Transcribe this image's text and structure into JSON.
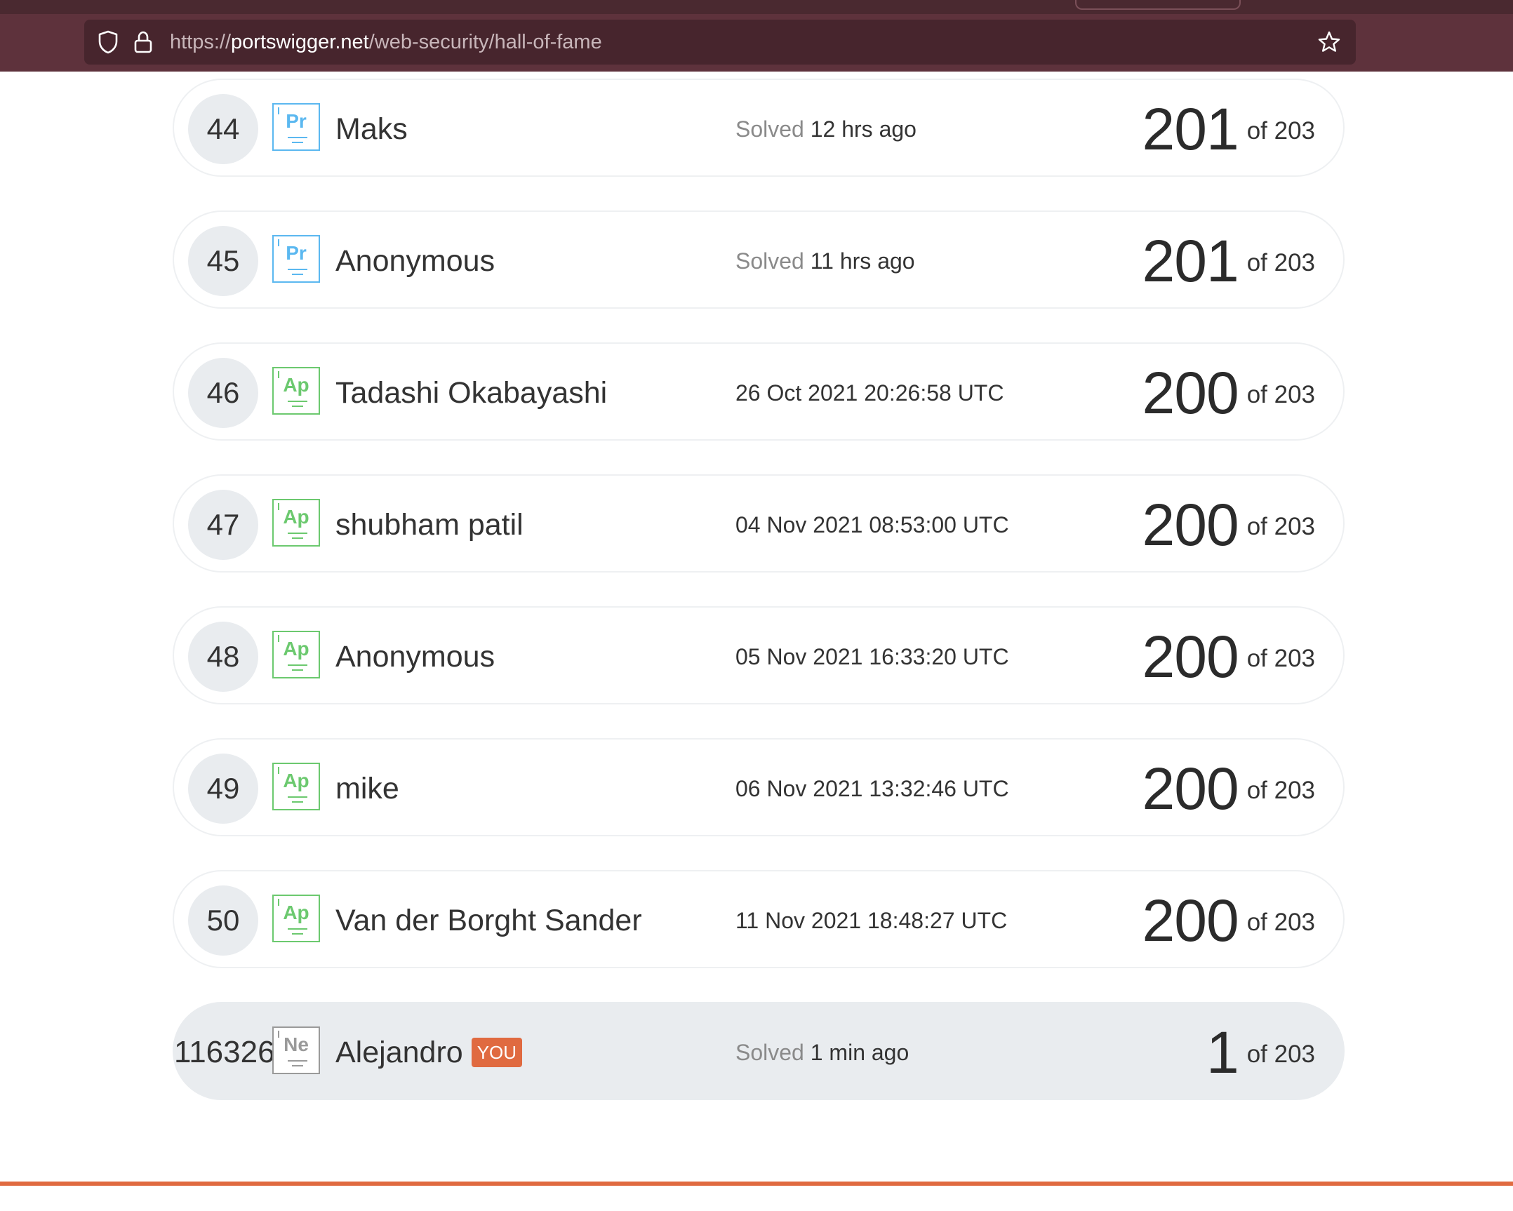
{
  "browser": {
    "url_prefix": "https://",
    "url_domain": "portswigger.net",
    "url_path": "/web-security/hall-of-fame"
  },
  "leaderboard": {
    "rows": [
      {
        "rank": "44",
        "badge": "Pr",
        "badge_color": "#5bb8f0",
        "name": "Maks",
        "solved_prefix": "Solved",
        "solved_value": "12 hrs ago",
        "score": "201",
        "total": "of 203"
      },
      {
        "rank": "45",
        "badge": "Pr",
        "badge_color": "#5bb8f0",
        "name": "Anonymous",
        "solved_prefix": "Solved",
        "solved_value": "11 hrs ago",
        "score": "201",
        "total": "of 203"
      },
      {
        "rank": "46",
        "badge": "Ap",
        "badge_color": "#6cc96f",
        "name": "Tadashi Okabayashi",
        "solved_prefix": "",
        "solved_value": "26 Oct 2021 20:26:58 UTC",
        "score": "200",
        "total": "of 203"
      },
      {
        "rank": "47",
        "badge": "Ap",
        "badge_color": "#6cc96f",
        "name": "shubham patil",
        "solved_prefix": "",
        "solved_value": "04 Nov 2021 08:53:00 UTC",
        "score": "200",
        "total": "of 203"
      },
      {
        "rank": "48",
        "badge": "Ap",
        "badge_color": "#6cc96f",
        "name": "Anonymous",
        "solved_prefix": "",
        "solved_value": "05 Nov 2021 16:33:20 UTC",
        "score": "200",
        "total": "of 203"
      },
      {
        "rank": "49",
        "badge": "Ap",
        "badge_color": "#6cc96f",
        "name": "mike",
        "solved_prefix": "",
        "solved_value": "06 Nov 2021 13:32:46 UTC",
        "score": "200",
        "total": "of 203"
      },
      {
        "rank": "50",
        "badge": "Ap",
        "badge_color": "#6cc96f",
        "name": "Van der Borght Sander",
        "solved_prefix": "",
        "solved_value": "11 Nov 2021 18:48:27 UTC",
        "score": "200",
        "total": "of 203"
      }
    ],
    "you_row": {
      "rank": "116326",
      "badge": "Ne",
      "badge_color": "#9a9a9a",
      "name": "Alejandro",
      "you_label": "YOU",
      "solved_prefix": "Solved",
      "solved_value": "1 min ago",
      "score": "1",
      "total": "of 203"
    }
  }
}
